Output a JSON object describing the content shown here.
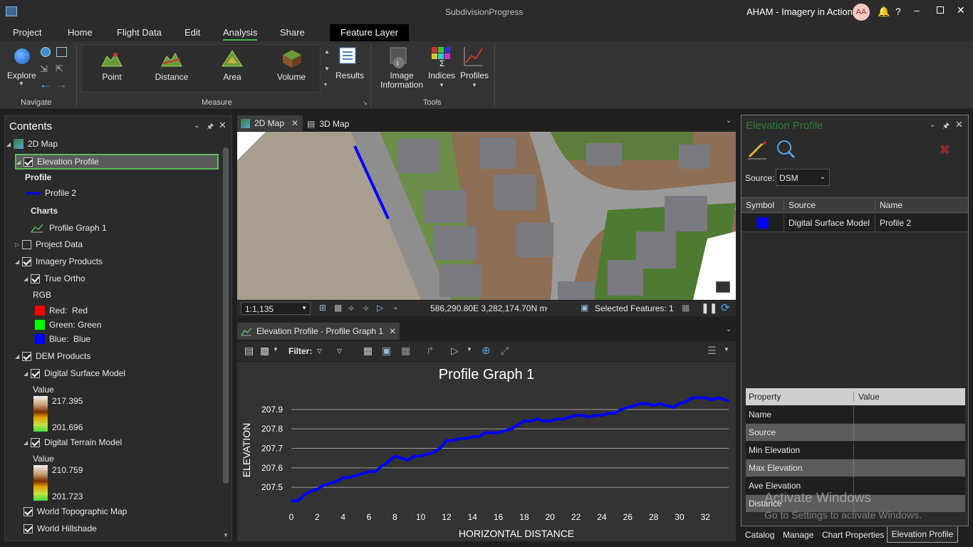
{
  "window": {
    "title": "SubdivisionProgress",
    "account": "AHAM - Imagery in Action",
    "initials": "AA"
  },
  "ribbon_tabs": [
    "Project",
    "Home",
    "Flight Data",
    "Edit",
    "Analysis",
    "Share"
  ],
  "contextual_tab": "Feature Layer",
  "ribbon": {
    "navigate": {
      "explore": "Explore",
      "group": "Navigate"
    },
    "measure": {
      "point": "Point",
      "distance": "Distance",
      "area": "Area",
      "volume": "Volume",
      "group": "Measure"
    },
    "results": "Results",
    "tools": {
      "image_information_1": "Image",
      "image_information_2": "Information",
      "indices": "Indices",
      "profiles": "Profiles",
      "group": "Tools"
    }
  },
  "contents": {
    "title": "Contents",
    "map_root": "2D Map",
    "elevation_profile": "Elevation Profile",
    "profile_header": "Profile",
    "profile_item": "Profile 2",
    "charts_header": "Charts",
    "chart_item": "Profile Graph 1",
    "project_data": "Project Data",
    "imagery_products": "Imagery Products",
    "true_ortho": "True Ortho",
    "rgb": "RGB",
    "red_label": "Red:  Red",
    "green_label": "Green: Green",
    "blue_label": "Blue:  Blue",
    "dem_products": "DEM Products",
    "dsm": "Digital Surface Model",
    "value1": "Value",
    "dsm_max": "217.395",
    "dsm_min": "201.696",
    "dtm": "Digital Terrain Model",
    "value2": "Value",
    "dtm_max": "210.759",
    "dtm_min": "201.723",
    "world_topo": "World Topographic Map",
    "world_hillshade": "World Hillshade"
  },
  "map": {
    "tab_2d": "2D Map",
    "tab_3d": "3D Map",
    "scale": "1:1,135",
    "coords": "586,290.80E 3,282,174.70N m",
    "selected": "Selected Features: 1"
  },
  "graph_panel": {
    "tab": "Elevation Profile - Profile Graph 1",
    "filter": "Filter:"
  },
  "chart_data": {
    "type": "line",
    "title": "Profile Graph 1",
    "xlabel": "HORIZONTAL DISTANCE",
    "ylabel": "ELEVATION",
    "xlim": [
      0,
      33.8
    ],
    "ylim": [
      207.42,
      207.98
    ],
    "xticks": [
      0,
      2,
      4,
      6,
      8,
      10,
      12,
      14,
      16,
      18,
      20,
      22,
      24,
      26,
      28,
      30,
      32
    ],
    "yticks": [
      207.5,
      207.6,
      207.7,
      207.8,
      207.9
    ],
    "grid": "horizontal",
    "series": [
      {
        "color": "#0000ff",
        "x": [
          0,
          0.5,
          1,
          1.5,
          2,
          2.5,
          3,
          3.5,
          4,
          4.5,
          5,
          5.5,
          6,
          6.5,
          7,
          7.5,
          8,
          8.5,
          9,
          9.5,
          10,
          10.5,
          11,
          11.5,
          12,
          12.5,
          13,
          13.5,
          14,
          14.5,
          15,
          15.5,
          16,
          16.5,
          17,
          17.5,
          18,
          18.5,
          19,
          19.5,
          20,
          20.5,
          21,
          21.5,
          22,
          22.5,
          23,
          23.5,
          24,
          24.5,
          25,
          25.5,
          26,
          26.5,
          27,
          27.5,
          28,
          28.5,
          29,
          29.5,
          30,
          30.5,
          31,
          31.5,
          32,
          32.5,
          33,
          33.5,
          33.8
        ],
        "y": [
          207.43,
          207.43,
          207.46,
          207.48,
          207.49,
          207.51,
          207.52,
          207.53,
          207.55,
          207.55,
          207.56,
          207.57,
          207.58,
          207.58,
          207.61,
          207.63,
          207.66,
          207.65,
          207.64,
          207.66,
          207.66,
          207.67,
          207.68,
          207.7,
          207.74,
          207.74,
          207.75,
          207.75,
          207.76,
          207.76,
          207.78,
          207.78,
          207.78,
          207.79,
          207.8,
          207.82,
          207.84,
          207.84,
          207.85,
          207.84,
          207.84,
          207.85,
          207.85,
          207.86,
          207.87,
          207.87,
          207.86,
          207.87,
          207.87,
          207.88,
          207.88,
          207.9,
          207.91,
          207.92,
          207.93,
          207.93,
          207.92,
          207.93,
          207.92,
          207.91,
          207.93,
          207.94,
          207.96,
          207.96,
          207.96,
          207.95,
          207.96,
          207.95,
          207.94
        ]
      }
    ]
  },
  "elev_panel": {
    "title": "Elevation Profile",
    "source_label": "Source:",
    "source_value": "DSM",
    "headers": [
      "Symbol",
      "Source",
      "Name"
    ],
    "row": {
      "source": "Digital Surface Model",
      "name": "Profile 2",
      "symbol_color": "#0000ff"
    },
    "prop_headers": [
      "Property",
      "Value"
    ],
    "props": [
      "Name",
      "Source",
      "Min Elevation",
      "Max Elevation",
      "Ave Elevation",
      "Distance"
    ],
    "watermark_1": "Activate Windows",
    "watermark_2": "Go to Settings to activate Windows."
  },
  "bottom_tabs": [
    "Catalog",
    "Manage",
    "Chart Properties",
    "Elevation Profile"
  ]
}
